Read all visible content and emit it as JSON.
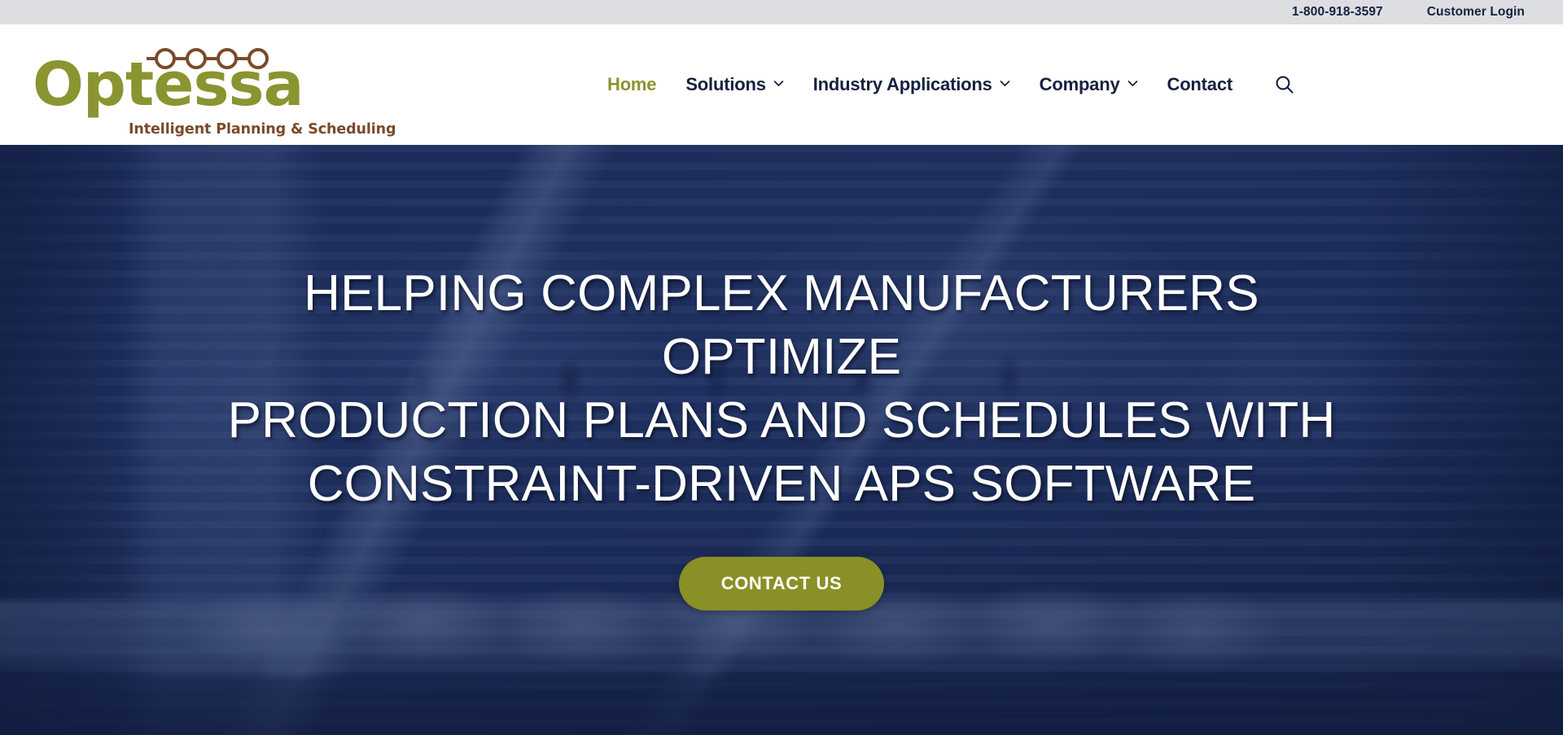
{
  "topbar": {
    "phone": "1-800-918-3597",
    "customer_login": "Customer Login"
  },
  "logo": {
    "wordmark": "Optessa",
    "tagline": "Intelligent Planning & Scheduling",
    "chain_dots": 4,
    "green": "#8a9430",
    "brown": "#7a4a2a"
  },
  "nav": {
    "items": [
      {
        "label": "Home",
        "has_dropdown": false,
        "active": true
      },
      {
        "label": "Solutions",
        "has_dropdown": true,
        "active": false
      },
      {
        "label": "Industry Applications",
        "has_dropdown": true,
        "active": false
      },
      {
        "label": "Company",
        "has_dropdown": true,
        "active": false
      },
      {
        "label": "Contact",
        "has_dropdown": false,
        "active": false
      }
    ],
    "search_icon": "search-icon",
    "active_color": "#8a9430",
    "text_color": "#14213f"
  },
  "hero": {
    "title_line1": "HELPING COMPLEX MANUFACTURERS OPTIMIZE",
    "title_line2": "PRODUCTION PLANS AND SCHEDULES WITH",
    "title_line3": "CONSTRAINT-DRIVEN APS SOFTWARE",
    "cta_label": "CONTACT US",
    "cta_color": "#8a8f26",
    "background_tint": "#24386c",
    "background_subject": "industrial manufacturing machinery, blue duotone"
  }
}
